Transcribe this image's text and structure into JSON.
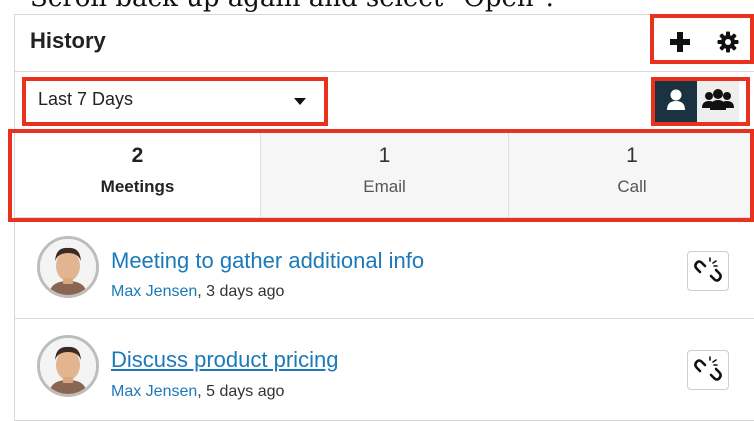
{
  "instruction": "Scroll back up again and select \"Open\".",
  "dashlet": {
    "title": "History",
    "add_icon": "plus-icon",
    "settings_icon": "gear-icon"
  },
  "filter": {
    "selected": "Last 7 Days",
    "caret_icon": "caret-down-icon",
    "my_items_icon": "user-icon",
    "team_icon": "users-group-icon",
    "active_toggle": "my-items"
  },
  "tabs": [
    {
      "count": "2",
      "label": "Meetings",
      "active": true
    },
    {
      "count": "1",
      "label": "Email",
      "active": false
    },
    {
      "count": "1",
      "label": "Call",
      "active": false
    }
  ],
  "items": [
    {
      "title": "Meeting to gather additional info",
      "user": "Max Jensen",
      "when": ", 3 days ago",
      "action_icon": "unlink-icon"
    },
    {
      "title": "Discuss product pricing",
      "user": "Max Jensen",
      "when": ", 5 days ago",
      "action_icon": "unlink-icon"
    }
  ],
  "colors": {
    "link": "#1b79b8",
    "highlight": "#e8321e",
    "toggle_active": "#1b3340"
  }
}
